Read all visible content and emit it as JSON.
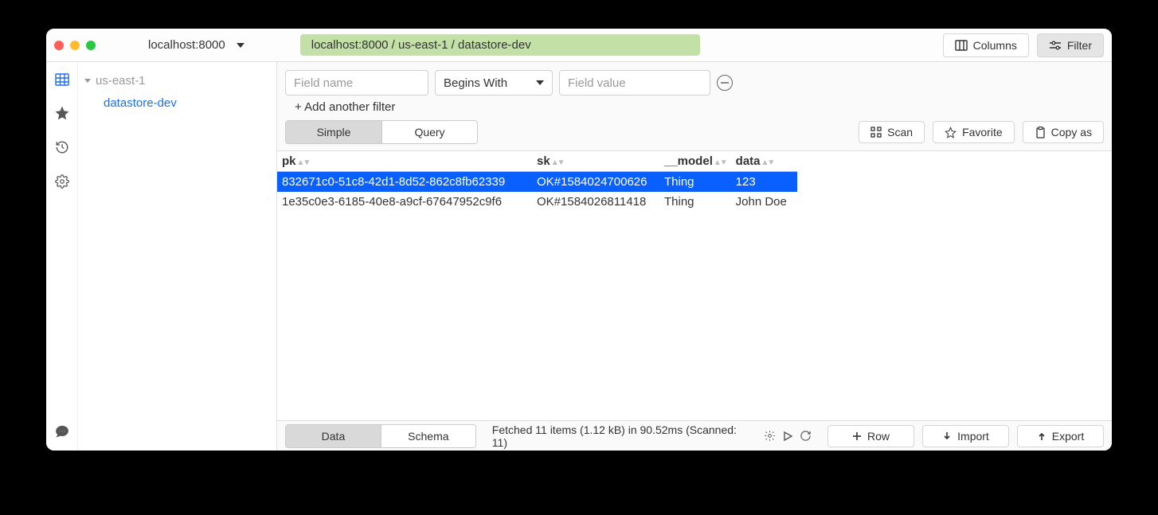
{
  "window": {
    "title": "localhost:8000",
    "breadcrumb": "localhost:8000 / us-east-1 / datastore-dev"
  },
  "titlebar": {
    "columns_label": "Columns",
    "filter_label": "Filter"
  },
  "sidebar": {
    "region": "us-east-1",
    "table": "datastore-dev"
  },
  "filters": {
    "field_name_placeholder": "Field name",
    "operator": "Begins With",
    "field_value_placeholder": "Field value",
    "add_another_label": "+ Add another filter"
  },
  "mode": {
    "simple_label": "Simple",
    "query_label": "Query",
    "scan_label": "Scan",
    "favorite_label": "Favorite",
    "copy_as_label": "Copy as"
  },
  "table": {
    "headers": {
      "pk": "pk",
      "sk": "sk",
      "model": "__model",
      "data": "data"
    },
    "rows": [
      {
        "pk": "832671c0-51c8-42d1-8d52-862c8fb62339",
        "sk": "OK#1584024700626",
        "model": "Thing",
        "data": "123"
      },
      {
        "pk": "1e35c0e3-6185-40e8-a9cf-67647952c9f6",
        "sk": "OK#1584026811418",
        "model": "Thing",
        "data": "John Doe"
      }
    ]
  },
  "footer": {
    "data_label": "Data",
    "schema_label": "Schema",
    "status": "Fetched 11 items (1.12 kB) in 90.52ms (Scanned: 11)",
    "row_label": "Row",
    "import_label": "Import",
    "export_label": "Export"
  }
}
